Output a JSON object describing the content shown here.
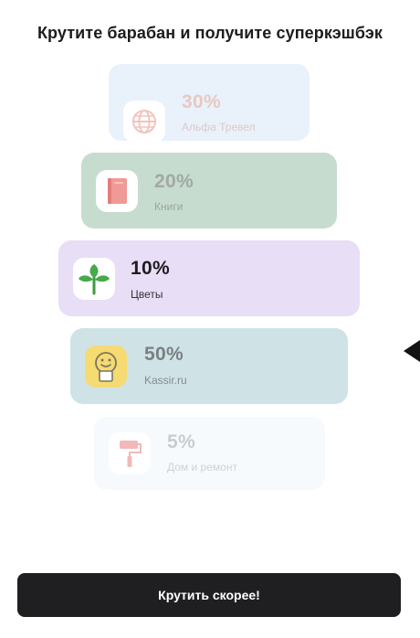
{
  "header": {
    "title": "Крутите барабан и получите суперкэшбэк"
  },
  "drum": {
    "items": [
      {
        "percent": "30%",
        "label": "Альфа Тревел",
        "icon": "globe-icon",
        "color": "#e9f1fb"
      },
      {
        "percent": "20%",
        "label": "Книги",
        "icon": "book-icon",
        "color": "#c6dccf"
      },
      {
        "percent": "10%",
        "label": "Цветы",
        "icon": "sprout-icon",
        "color": "#e8def6"
      },
      {
        "percent": "50%",
        "label": "Kassir.ru",
        "icon": "smiley-ticket-icon",
        "color": "#cfe3e6"
      },
      {
        "percent": "5%",
        "label": "Дом и ремонт",
        "icon": "paint-roller-icon",
        "color": "#f7fafd"
      }
    ],
    "selected_index": 2,
    "pointer_icon": "pointer-arrow-icon"
  },
  "footer": {
    "spin_label": "Крутить скорее!"
  }
}
